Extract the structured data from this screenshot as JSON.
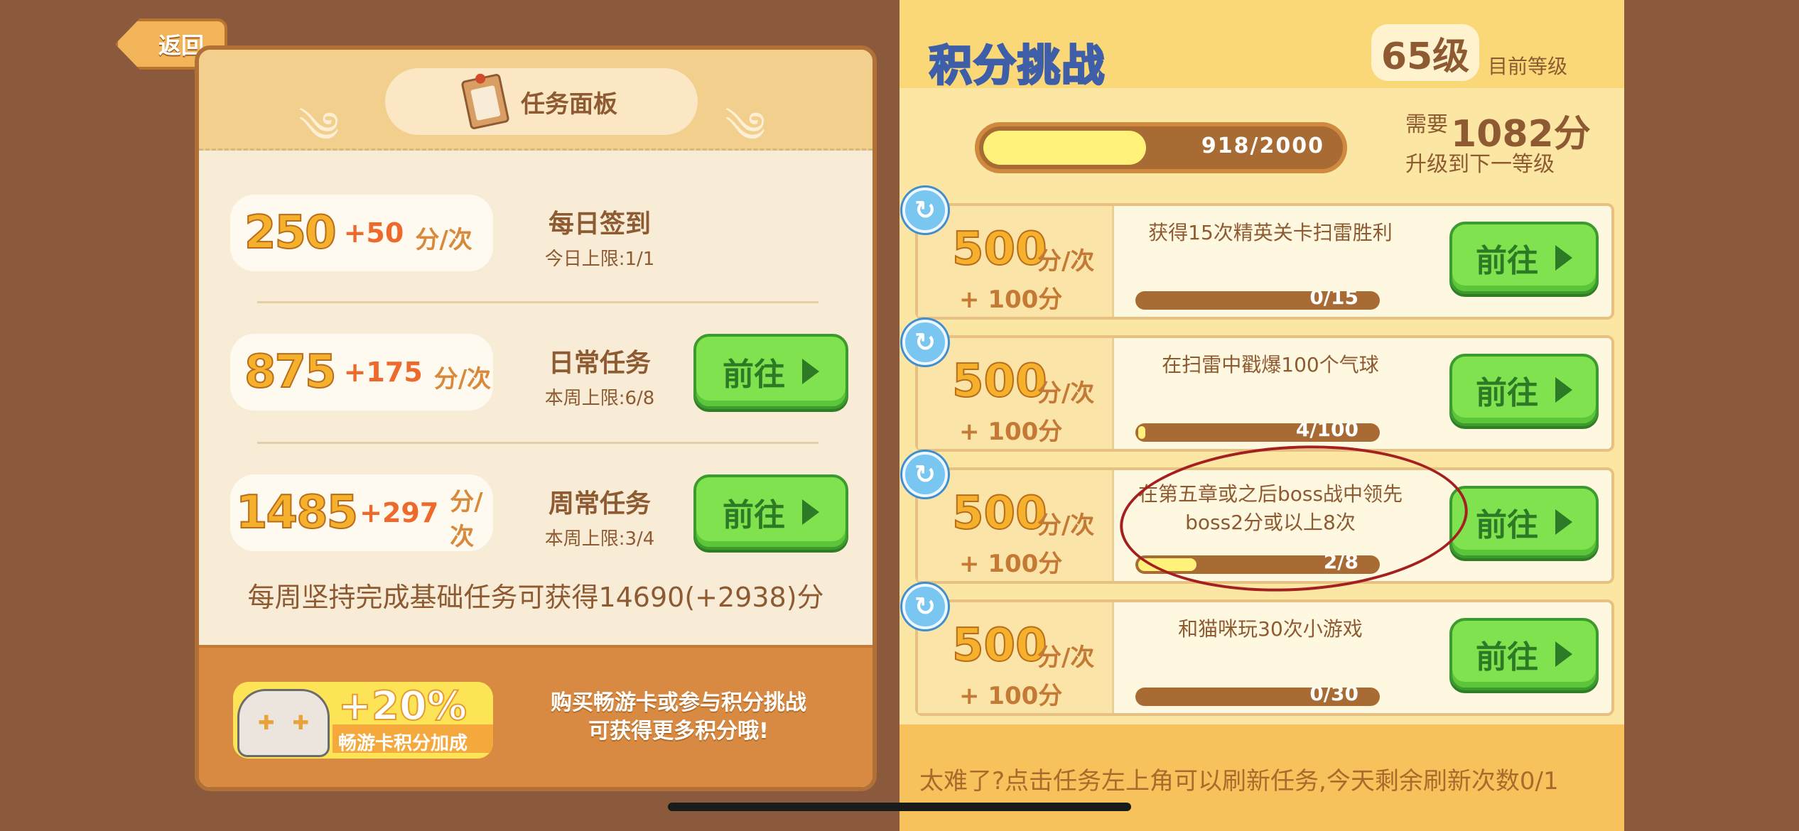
{
  "back_button": {
    "label": "返回"
  },
  "task_panel": {
    "title": "任务面板",
    "tasks": [
      {
        "score": "250",
        "bonus": "+50",
        "unit": "分/次",
        "name": "每日签到",
        "limit": "今日上限:1/1",
        "has_go": false
      },
      {
        "score": "875",
        "bonus": "+175",
        "unit": "分/次",
        "name": "日常任务",
        "limit": "本周上限:6/8",
        "has_go": true,
        "go_label": "前往"
      },
      {
        "score": "1485",
        "bonus": "+297",
        "unit": "分/次",
        "name": "周常任务",
        "limit": "本周上限:3/4",
        "has_go": true,
        "go_label": "前往"
      }
    ],
    "weekly_note": "每周坚持完成基础任务可获得14690(+2938)分",
    "bonus": {
      "percent": "+20%",
      "label": "畅游卡积分加成"
    },
    "footer_text": [
      "购买畅游卡或参与积分挑战",
      "可获得更多积分哦!"
    ]
  },
  "challenge": {
    "title": "积分挑战",
    "level": "65级",
    "level_label": "目前等级",
    "progress_text": "918/2000",
    "progress_fraction": 0.459,
    "need_label": "需要",
    "need_points": "1082分",
    "next_label": "升级到下一等级",
    "cards": [
      {
        "score": "500",
        "unit": "分/次",
        "bonus": "+ 100分",
        "desc": "获得15次精英关卡扫雷胜利",
        "progress": "0/15",
        "fraction": 0.0,
        "go_label": "前往"
      },
      {
        "score": "500",
        "unit": "分/次",
        "bonus": "+ 100分",
        "desc": "在扫雷中戳爆100个气球",
        "progress": "4/100",
        "fraction": 0.04,
        "go_label": "前往"
      },
      {
        "score": "500",
        "unit": "分/次",
        "bonus": "+ 100分",
        "desc": "在第五章或之后boss战中领先boss2分或以上8次",
        "progress": "2/8",
        "fraction": 0.25,
        "go_label": "前往"
      },
      {
        "score": "500",
        "unit": "分/次",
        "bonus": "+ 100分",
        "desc": "和猫咪玩30次小游戏",
        "progress": "0/30",
        "fraction": 0.0,
        "go_label": "前往"
      }
    ],
    "footer": "太难了?点击任务左上角可以刷新任务,今天剩余刷新次数0/1"
  },
  "icons": {
    "refresh": "refresh-icon",
    "play": "play-icon",
    "clipboard": "clipboard-icon",
    "cat": "cat-icon"
  },
  "colors": {
    "background": "#8B5A3C",
    "go_button": "#7fe24e",
    "score": "#f5b12c",
    "accent_blue": "#6cc6f4"
  }
}
